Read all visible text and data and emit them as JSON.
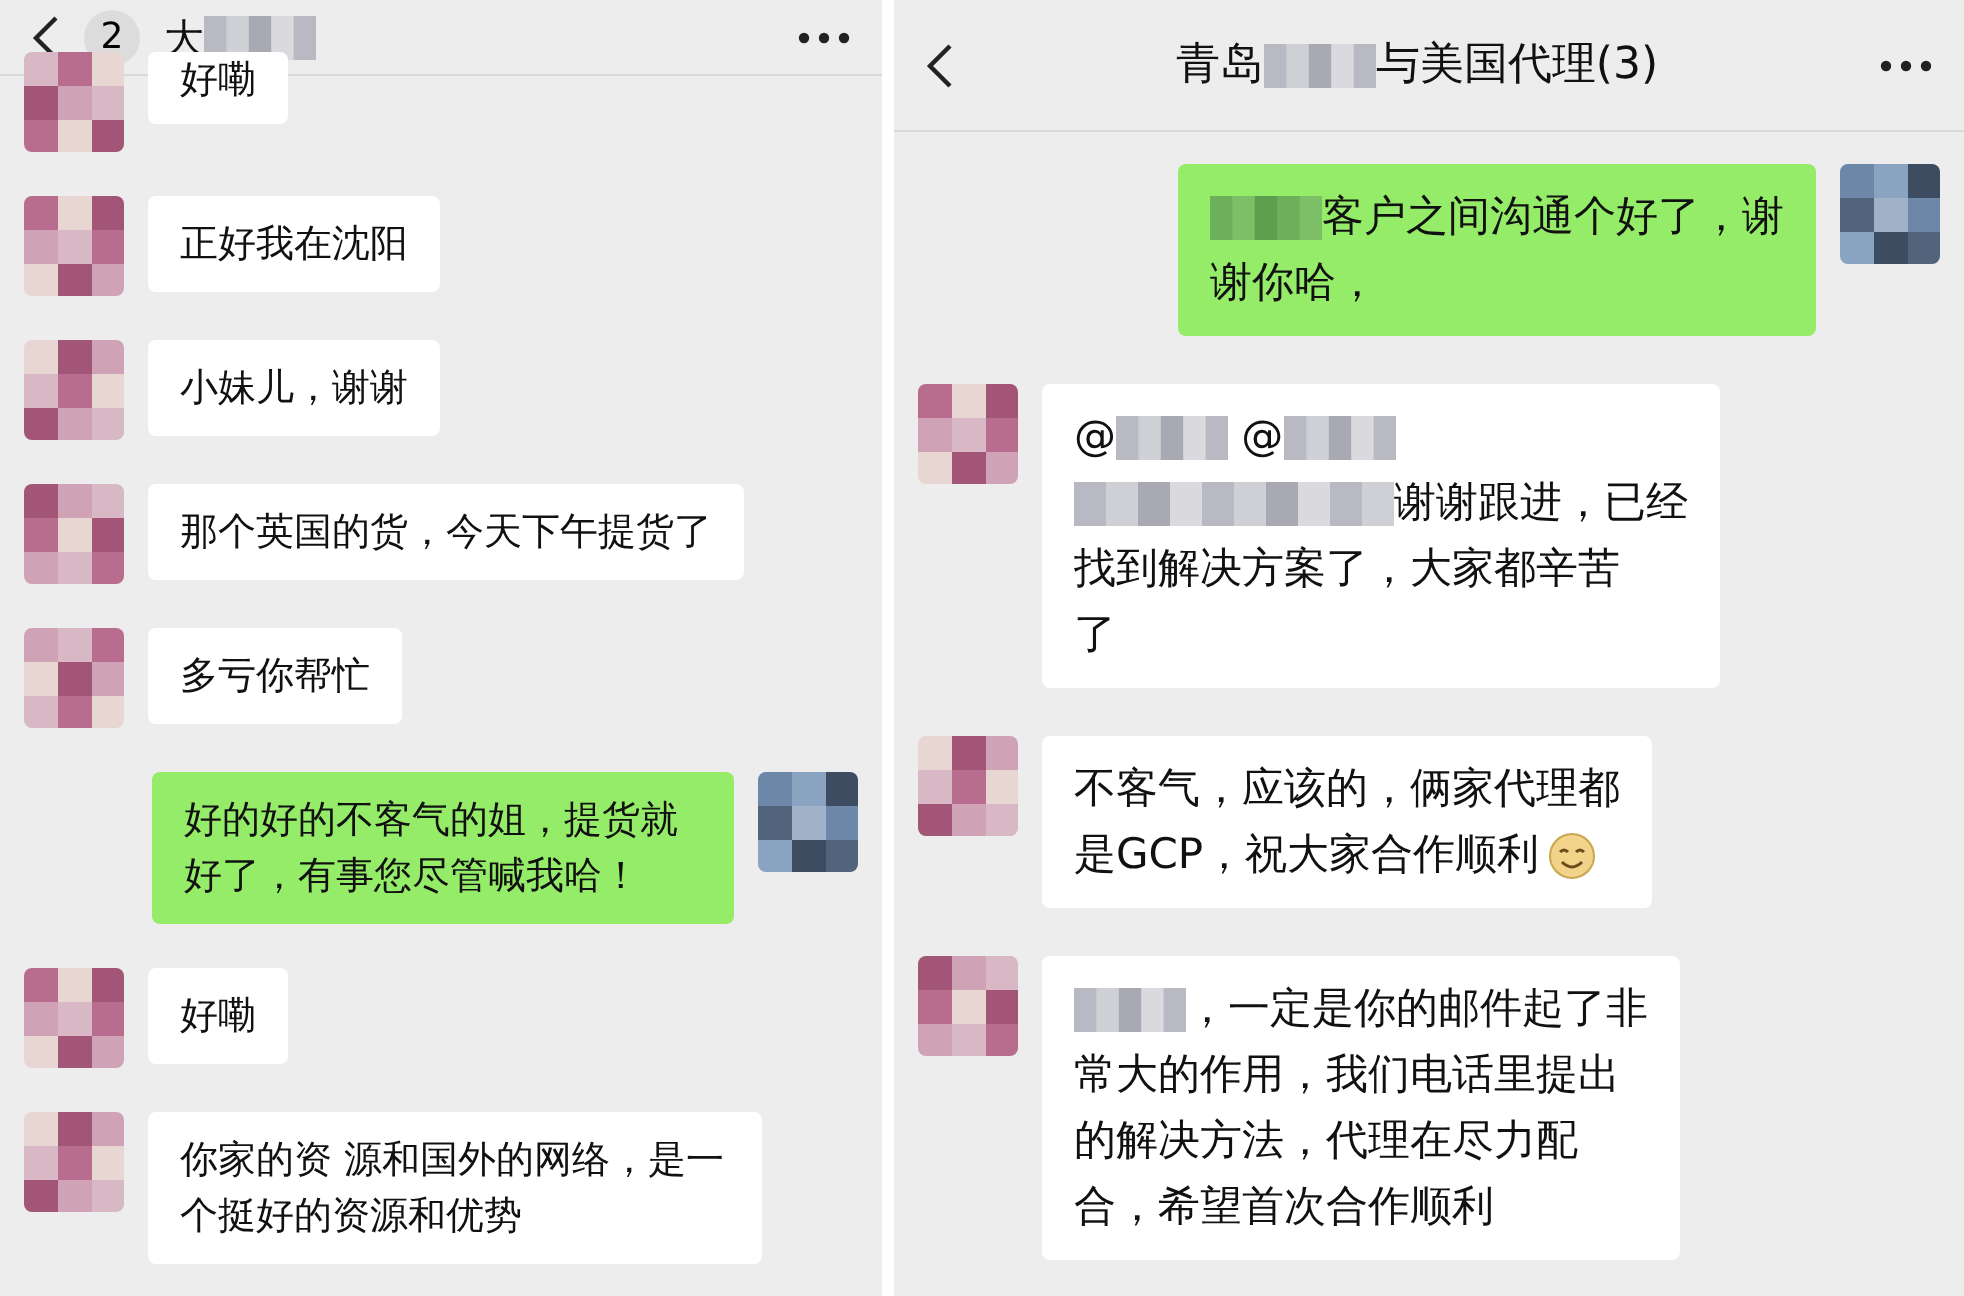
{
  "panels": [
    {
      "header": {
        "badge": "2",
        "title_parts": [
          {
            "kind": "text",
            "text": "大"
          },
          {
            "kind": "mosaic"
          }
        ]
      },
      "messages": [
        {
          "from_me": false,
          "cut": true,
          "parts": [
            {
              "kind": "text",
              "text": "好嘞"
            }
          ]
        },
        {
          "from_me": false,
          "parts": [
            {
              "kind": "text",
              "text": "正好我在沈阳"
            }
          ]
        },
        {
          "from_me": false,
          "parts": [
            {
              "kind": "text",
              "text": "小妹儿，谢谢"
            }
          ]
        },
        {
          "from_me": false,
          "parts": [
            {
              "kind": "text",
              "text": "那个英国的货，今天下午提货了"
            }
          ]
        },
        {
          "from_me": false,
          "parts": [
            {
              "kind": "text",
              "text": "多亏你帮忙"
            }
          ]
        },
        {
          "from_me": true,
          "parts": [
            {
              "kind": "text",
              "text": "好的好的不客气的姐，提货就好了，有事您尽管喊我哈！"
            }
          ]
        },
        {
          "from_me": false,
          "parts": [
            {
              "kind": "text",
              "text": "好嘞"
            }
          ]
        },
        {
          "from_me": false,
          "parts": [
            {
              "kind": "text",
              "text": "你家的资 源和国外的网络，是一个挺好的资源和优势"
            }
          ]
        }
      ]
    },
    {
      "header": {
        "title_parts": [
          {
            "kind": "text",
            "text": "青岛"
          },
          {
            "kind": "mosaic"
          },
          {
            "kind": "text",
            "text": "与美国代理(3)"
          }
        ]
      },
      "messages": [
        {
          "from_me": true,
          "parts": [
            {
              "kind": "mosaic"
            },
            {
              "kind": "text",
              "text": "客户之间沟通个好了，谢"
            },
            {
              "kind": "break"
            },
            {
              "kind": "text",
              "text": "谢你哈，"
            }
          ]
        },
        {
          "from_me": false,
          "parts": [
            {
              "kind": "text",
              "text": "@"
            },
            {
              "kind": "mosaic"
            },
            {
              "kind": "text",
              "text": " @"
            },
            {
              "kind": "mosaic"
            },
            {
              "kind": "break"
            },
            {
              "kind": "mosaic_wide"
            },
            {
              "kind": "text",
              "text": "谢谢跟进，已经"
            },
            {
              "kind": "break"
            },
            {
              "kind": "text",
              "text": "找到解决方案了，大家都辛苦"
            },
            {
              "kind": "break"
            },
            {
              "kind": "text",
              "text": "了"
            }
          ]
        },
        {
          "from_me": false,
          "parts": [
            {
              "kind": "text",
              "text": "不客气，应该的，俩家代理都"
            },
            {
              "kind": "break"
            },
            {
              "kind": "text",
              "text": "是GCP，祝大家合作顺利"
            },
            {
              "kind": "smiley"
            }
          ]
        },
        {
          "from_me": false,
          "parts": [
            {
              "kind": "mosaic"
            },
            {
              "kind": "text",
              "text": "，一定是你的邮件起了非"
            },
            {
              "kind": "break"
            },
            {
              "kind": "text",
              "text": "常大的作用，我们电话里提出"
            },
            {
              "kind": "break"
            },
            {
              "kind": "text",
              "text": "的解决方法，代理在尽力配"
            },
            {
              "kind": "break"
            },
            {
              "kind": "text",
              "text": "合，希望首次合作顺利"
            }
          ]
        }
      ]
    }
  ]
}
